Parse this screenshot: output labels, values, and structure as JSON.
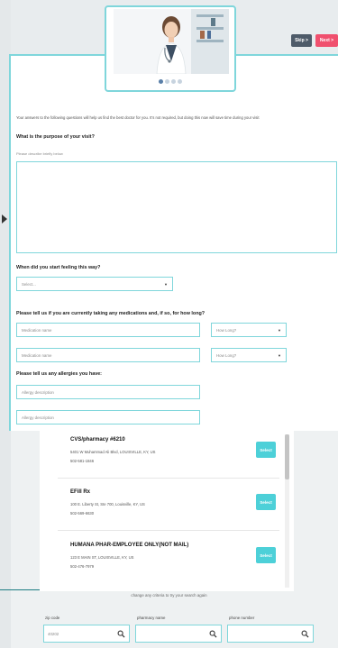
{
  "header": {
    "skip_label": "Skip >",
    "next_label": "Next >",
    "carousel_dots": [
      true,
      false,
      false,
      false
    ],
    "carousel_level": 0.25
  },
  "form": {
    "intro": "Your answers to the following questions will help us find the best doctor for you. It's not required, but doing this now will save time during your visit",
    "purpose_question": "What is the purpose of your visit?",
    "purpose_hint": "Please describe briefly below",
    "start_question": "When did you start feeling this way?",
    "start_select": "Select...",
    "meds_question": "Please tell us if you are currently taking any medications and, if so, for how long?",
    "medications": [
      {
        "name_placeholder": "Medication name",
        "duration_placeholder": "How Long?"
      },
      {
        "name_placeholder": "Medication name",
        "duration_placeholder": "How Long?"
      }
    ],
    "allergies_question": "Please tell us any allergies you have:",
    "allergies": [
      {
        "placeholder": "Allergy description"
      },
      {
        "placeholder": "Allergy description"
      }
    ]
  },
  "pharmacies": {
    "items": [
      {
        "name": "CVS/pharmacy #6210",
        "address": "5401 W Muhammad Ali Blvd, LOUISVILLE, KY, US",
        "phone": "502-581-1846",
        "button": "Select"
      },
      {
        "name": "EFill Rx",
        "address": "100 E. Liberty St, Ste 700, Louisville, KY, US",
        "phone": "502-569-6630",
        "button": "Select"
      },
      {
        "name": "HUMANA PHAR-EMPLOYEE ONLY(NOT MAIL)",
        "address": "123 E MAIN ST, LOUISVILLE, KY, US",
        "phone": "502-476-7979",
        "button": "Select"
      }
    ],
    "change_msg": "change any criteria to try your search again",
    "search": {
      "zip_label": "zip code",
      "zip_value": "40202",
      "pharmacy_label": "pharmacy name",
      "pharmacy_value": "",
      "phone_label": "phone number",
      "phone_value": ""
    }
  },
  "colors": {
    "accent_teal": "#7fd6db",
    "select_button": "#4dd0d8",
    "next_button": "#f0506e",
    "skip_button": "#4e5b69"
  },
  "icons": {
    "search": "magnifier-icon",
    "dropdown": "caret-down-icon",
    "collapse": "triangle-right-icon"
  }
}
